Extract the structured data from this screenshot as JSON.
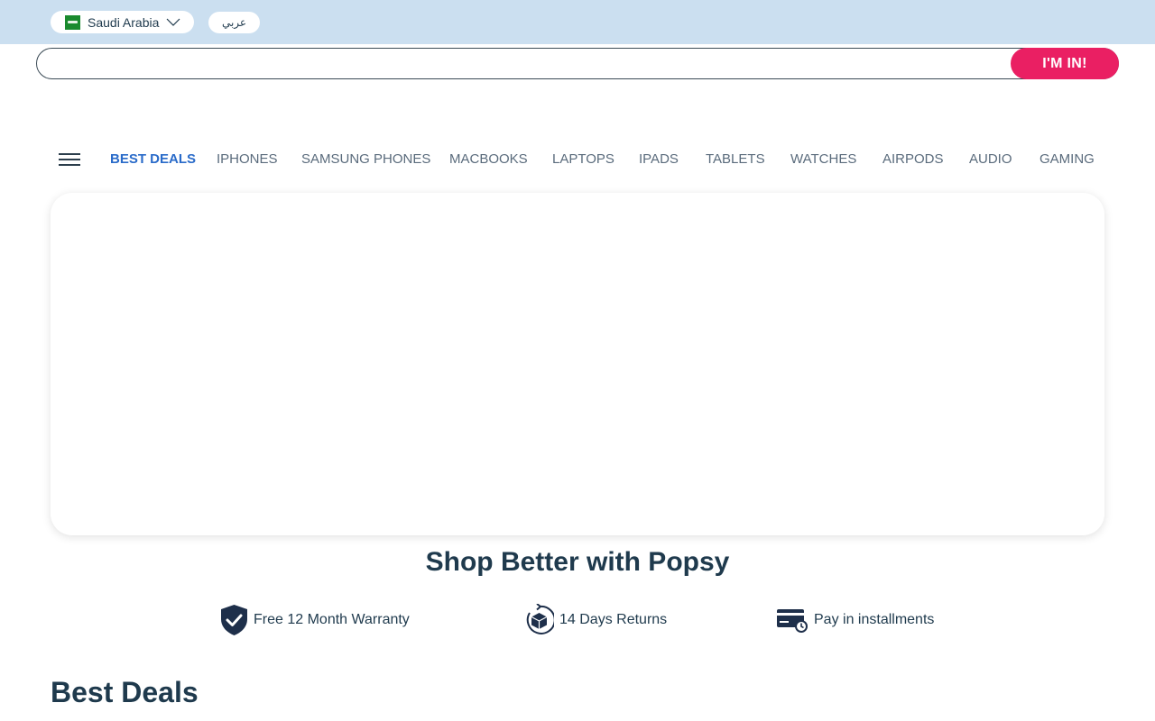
{
  "topbar": {
    "country": "Saudi Arabia",
    "language_toggle": "عربي"
  },
  "search": {
    "value": "",
    "placeholder": "",
    "button_label": "I'M IN!"
  },
  "nav": {
    "items": [
      {
        "label": "BEST DEALS",
        "active": true
      },
      {
        "label": "IPHONES"
      },
      {
        "label": "SAMSUNG PHONES"
      },
      {
        "label": "MACBOOKS"
      },
      {
        "label": "LAPTOPS"
      },
      {
        "label": "IPADS"
      },
      {
        "label": "TABLETS"
      },
      {
        "label": "WATCHES"
      },
      {
        "label": "AIRPODS"
      },
      {
        "label": "AUDIO"
      },
      {
        "label": "GAMING"
      }
    ]
  },
  "why": {
    "title": "Shop Better with Popsy",
    "features": [
      {
        "label": "Free 12 Month Warranty",
        "icon": "shield-check-icon"
      },
      {
        "label": "14 Days Returns",
        "icon": "box-return-icon"
      },
      {
        "label": "Pay in installments",
        "icon": "credit-card-icon"
      }
    ]
  },
  "deals": {
    "title": "Best Deals"
  },
  "colors": {
    "topbar_bg": "#cbdff0",
    "accent_pink": "#ea1f63",
    "nav_active": "#2a6bc9",
    "text_dark": "#1f3a4d"
  }
}
